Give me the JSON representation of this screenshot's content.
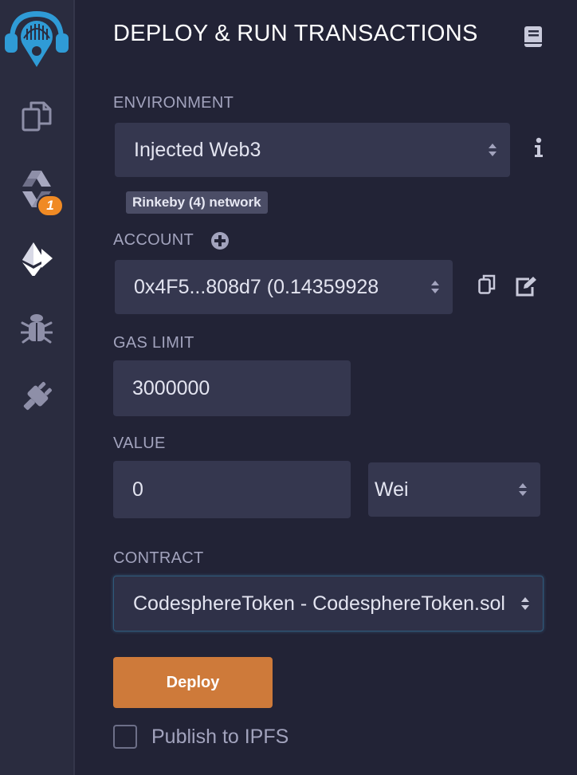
{
  "sidebar": {
    "badge_count": "1",
    "icons": [
      "remix-logo-icon",
      "file-explorer-icon",
      "solidity-compiler-icon",
      "deploy-run-icon",
      "debugger-icon",
      "plugin-manager-icon"
    ]
  },
  "panel": {
    "title": "DEPLOY & RUN TRANSACTIONS"
  },
  "environment": {
    "label": "ENVIRONMENT",
    "value": "Injected Web3",
    "network_tag": "Rinkeby (4) network"
  },
  "account": {
    "label": "ACCOUNT",
    "value": "0x4F5...808d7 (0.14359928"
  },
  "gas_limit": {
    "label": "GAS LIMIT",
    "value": "3000000"
  },
  "value_field": {
    "label": "VALUE",
    "amount": "0",
    "unit": "Wei"
  },
  "contract": {
    "label": "CONTRACT",
    "value": "CodesphereToken - CodesphereToken.sol"
  },
  "deploy": {
    "label": "Deploy"
  },
  "publish": {
    "label": "Publish to IPFS",
    "checked": false
  },
  "colors": {
    "background": "#222336",
    "sidebar": "#2a2c3f",
    "accent_blue": "#2f9bd6",
    "deploy_orange": "#ce7a3a",
    "badge_orange": "#f08a24"
  }
}
